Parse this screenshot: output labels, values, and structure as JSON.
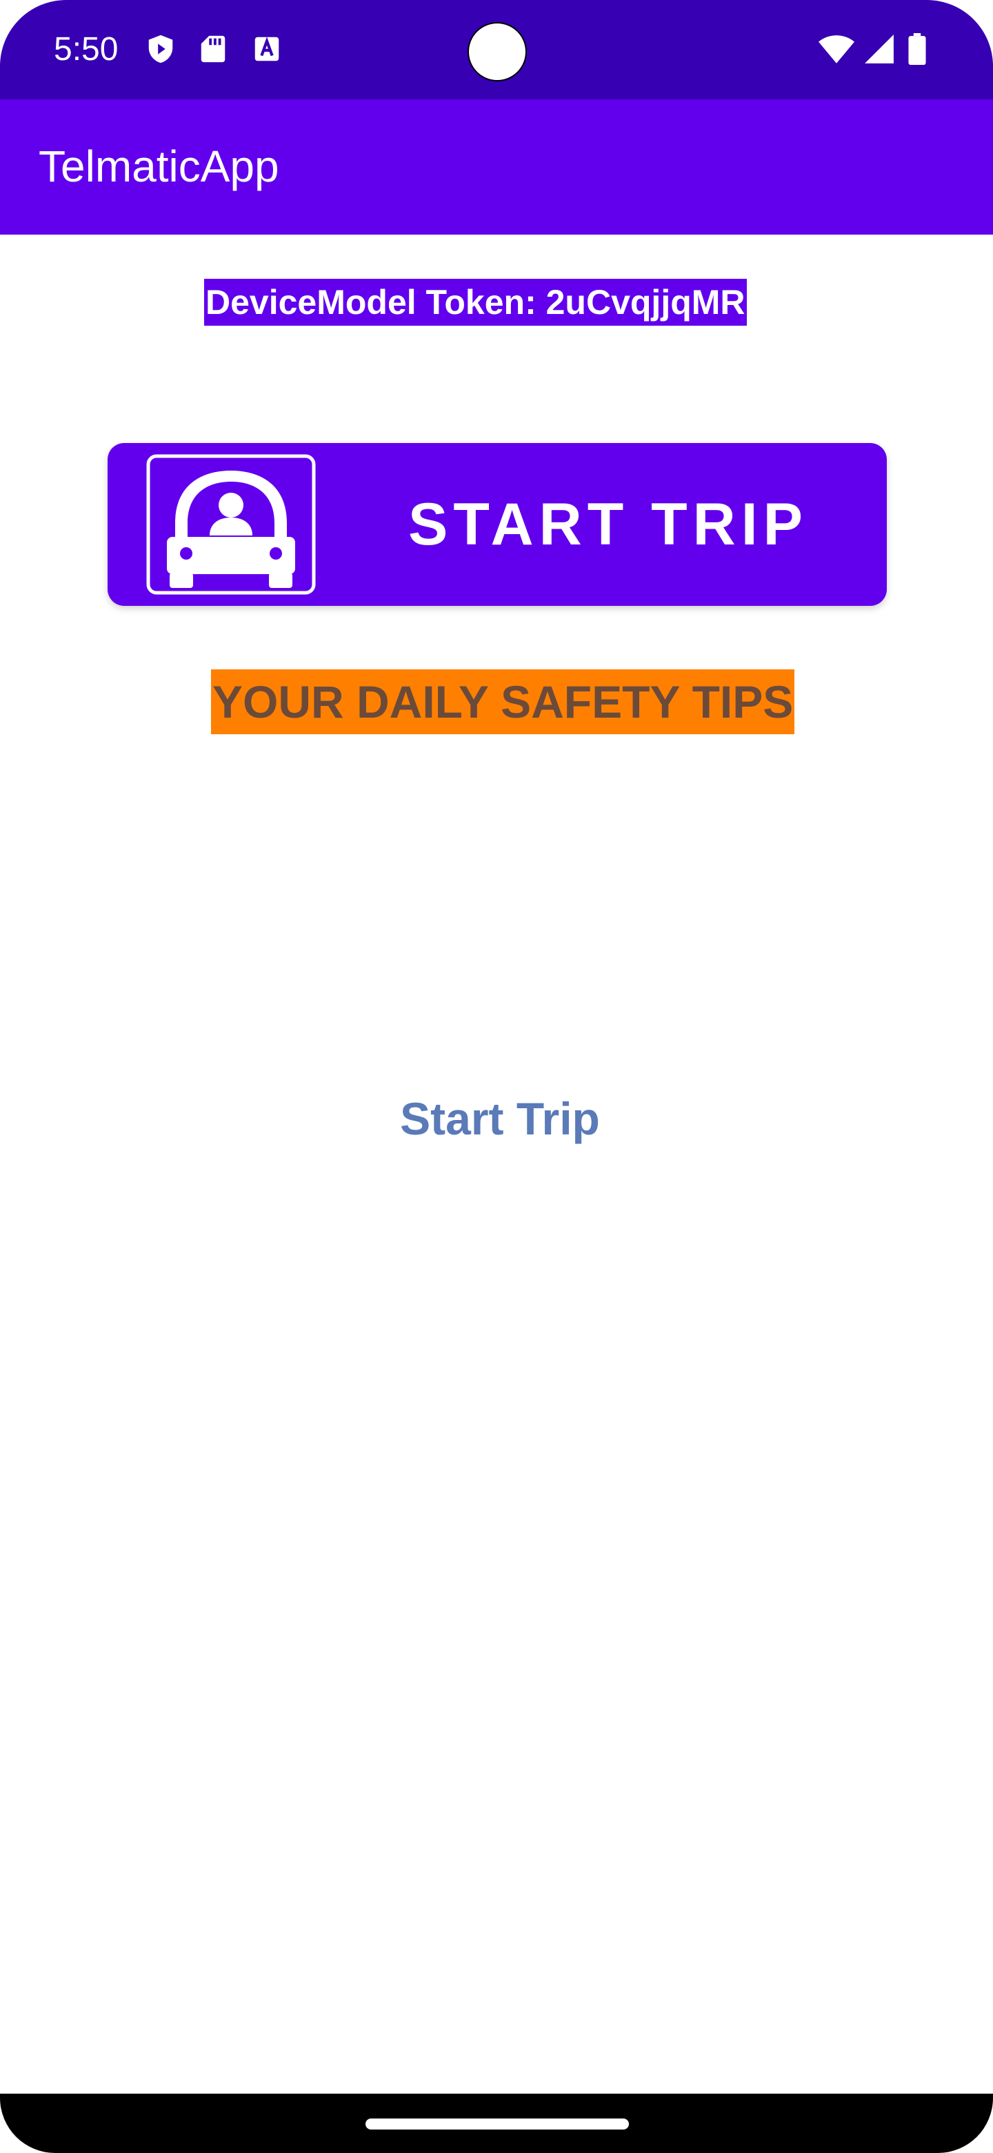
{
  "status_bar": {
    "time": "5:50",
    "background": "#3700B3",
    "left_icons": [
      "play-shield-icon",
      "sd-card-icon",
      "text-a-icon"
    ],
    "right_icons": [
      "wifi-icon",
      "cellular-signal-icon",
      "battery-icon"
    ]
  },
  "app_bar": {
    "title": "TelmaticApp",
    "background": "#6200EE"
  },
  "token": {
    "label": "DeviceModel Token: 2uCvqjjqMR"
  },
  "start_trip_button": {
    "label": "START TRIP",
    "icon": "car-driver-icon",
    "background": "#6200EE"
  },
  "safety_tips": {
    "label": "YOUR DAILY SAFETY TIPS",
    "background": "#FF8000",
    "text_color": "#6B4A3A"
  },
  "start_trip_link": {
    "label": "Start Trip",
    "color": "#5A7AB8"
  }
}
